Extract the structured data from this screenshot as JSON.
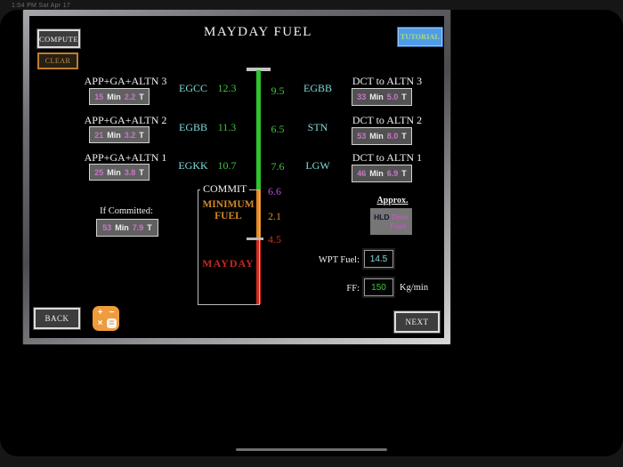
{
  "status_bar": {
    "text": "1:04 PM  Sat Apr 17"
  },
  "header": {
    "title": "MAYDAY FUEL",
    "compute_label": "COMPUTE",
    "clear_label": "CLEAR",
    "tutorial_label": "TUTORIAL"
  },
  "left_rows": [
    {
      "label": "APP+GA+ALTN 3",
      "min": "15",
      "min_unit": "Min",
      "tons": "2.2",
      "tons_unit": "T"
    },
    {
      "label": "APP+GA+ALTN 2",
      "min": "21",
      "min_unit": "Min",
      "tons": "3.2",
      "tons_unit": "T"
    },
    {
      "label": "APP+GA+ALTN 1",
      "min": "25",
      "min_unit": "Min",
      "tons": "3.8",
      "tons_unit": "T"
    }
  ],
  "right_rows": [
    {
      "label": "DCT  to ALTN 3",
      "min": "33",
      "min_unit": "Min",
      "tons": "5.0",
      "tons_unit": "T"
    },
    {
      "label": "DCT to ALTN 2",
      "min": "53",
      "min_unit": "Min",
      "tons": "8.0",
      "tons_unit": "T"
    },
    {
      "label": "DCT  to ALTN 1",
      "min": "46",
      "min_unit": "Min",
      "tons": "6.9",
      "tons_unit": "T"
    }
  ],
  "scale": {
    "left_airports": [
      "EGCC",
      "EGBB",
      "EGKK"
    ],
    "left_values": [
      "12.3",
      "11.3",
      "10.7"
    ],
    "right_values": [
      "9.5",
      "6.5",
      "7.6"
    ],
    "right_airports": [
      "EGBB",
      "STN",
      "LGW"
    ],
    "commit_label": "COMMIT",
    "commit_value": "6.6",
    "minimum_fuel_label": "MINIMUM FUEL",
    "minimum_fuel_value": "2.1",
    "mayday_label": "MAYDAY",
    "mayday_value": "4.5"
  },
  "if_committed": {
    "label": "If Committed:",
    "min": "53",
    "min_unit": "Min",
    "tons": "7.9",
    "tons_unit": "T"
  },
  "hld_panel": {
    "approx_label": "Approx.",
    "hld_label": "HLD",
    "time_label": "Time",
    "fuel_label": "Fuel"
  },
  "inputs": {
    "wpt_label": "WPT Fuel:",
    "wpt_value": "14.5",
    "ff_label": "FF:",
    "ff_value": "150",
    "ff_unit": "Kg/min"
  },
  "footer": {
    "back_label": "BACK",
    "next_label": "NEXT"
  },
  "calculator_icon": {
    "plus": "+",
    "minus": "−",
    "times": "×",
    "equals": "="
  },
  "colors": {
    "bar_green": "#2ec42e",
    "bar_orange": "#e08a28",
    "bar_red": "#d42a1e",
    "airport_cyan": "#82dcdc",
    "value_magenta": "#c678c6",
    "commit_purple": "#b44fd0",
    "tutorial_blue": "#4f9de8",
    "clear_orange": "#c07c2a",
    "calc_orange": "#f09b3c"
  }
}
